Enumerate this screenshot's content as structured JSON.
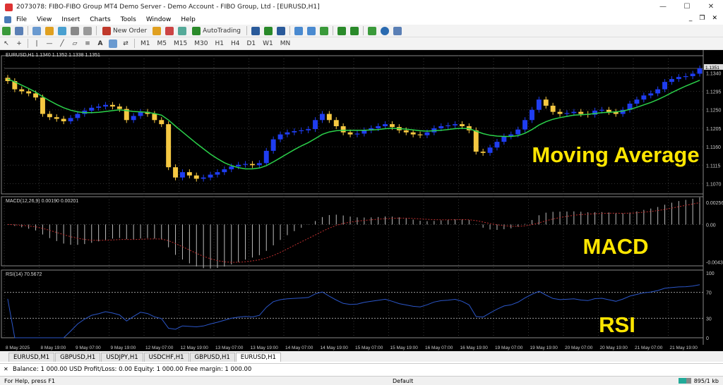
{
  "window": {
    "title": "2073078: FIBO-FIBO Group MT4 Demo Server - Demo Account - FIBO Group, Ltd - [EURUSD,H1]",
    "minimize": "—",
    "maximize": "☐",
    "close": "✕"
  },
  "menu": {
    "items": [
      "File",
      "View",
      "Insert",
      "Charts",
      "Tools",
      "Window",
      "Help"
    ],
    "mdi_min": "_",
    "mdi_restore": "❐",
    "mdi_close": "✕"
  },
  "toolbar": {
    "new_order": "New Order",
    "autotrading": "AutoTrading",
    "timeframes": [
      "M1",
      "M5",
      "M15",
      "M30",
      "H1",
      "H4",
      "D1",
      "W1",
      "MN"
    ]
  },
  "chart": {
    "header": "EURUSD,H1  1.1340 1.1352 1.1338 1.1351",
    "macd_header": "MACD(12,26,9) 0.00190 0.00201",
    "rsi_header": "RSI(14) 70.5672",
    "annotations": {
      "moving_average": "Moving Average",
      "macd": "MACD",
      "rsi": "RSI"
    },
    "colors": {
      "bull": "#1f3df0",
      "bear": "#f5c842",
      "ma": "#2bd14a",
      "rsi": "#2b56c8",
      "annotation": "#ffe600"
    }
  },
  "chart_data": [
    {
      "type": "candlestick",
      "name": "EURUSD,H1",
      "price_ticks": [
        "1.1340",
        "1.1295",
        "1.1250",
        "1.1205",
        "1.1160",
        "1.1115",
        "1.1070"
      ],
      "current_price": "1.1351",
      "ylim": [
        1.1045,
        1.1375
      ],
      "close": [
        1.132,
        1.13,
        1.1295,
        1.129,
        1.128,
        1.124,
        1.1232,
        1.1228,
        1.1222,
        1.123,
        1.124,
        1.1248,
        1.1255,
        1.1258,
        1.1262,
        1.1258,
        1.1252,
        1.1225,
        1.1235,
        1.1245,
        1.124,
        1.1225,
        1.1215,
        1.111,
        1.1085,
        1.1098,
        1.109,
        1.1082,
        1.1085,
        1.1092,
        1.1098,
        1.1105,
        1.1112,
        1.1116,
        1.1118,
        1.1115,
        1.112,
        1.115,
        1.1178,
        1.119,
        1.1195,
        1.1198,
        1.12,
        1.1203,
        1.1225,
        1.124,
        1.1225,
        1.121,
        1.1195,
        1.119,
        1.1192,
        1.12,
        1.1205,
        1.121,
        1.1215,
        1.1208,
        1.12,
        1.1195,
        1.119,
        1.1188,
        1.1195,
        1.1205,
        1.121,
        1.1212,
        1.1215,
        1.121,
        1.12,
        1.1148,
        1.1145,
        1.1158,
        1.1172,
        1.1185,
        1.119,
        1.1202,
        1.1225,
        1.125,
        1.1275,
        1.126,
        1.1245,
        1.124,
        1.1242,
        1.1245,
        1.124,
        1.1238,
        1.1248,
        1.125,
        1.1245,
        1.124,
        1.125,
        1.1265,
        1.1275,
        1.1285,
        1.129,
        1.13,
        1.1318,
        1.1325,
        1.133,
        1.1332,
        1.1338,
        1.1351
      ],
      "ma": [
        1.1325,
        1.1318,
        1.131,
        1.1302,
        1.1293,
        1.1282,
        1.1272,
        1.1263,
        1.1255,
        1.1249,
        1.1245,
        1.1243,
        1.1243,
        1.1244,
        1.1246,
        1.1248,
        1.125,
        1.1248,
        1.1246,
        1.1245,
        1.1244,
        1.1241,
        1.1237,
        1.1225,
        1.121,
        1.1196,
        1.1182,
        1.1168,
        1.1155,
        1.1142,
        1.1131,
        1.1121,
        1.1114,
        1.1109,
        1.1106,
        1.1106,
        1.1108,
        1.1114,
        1.1123,
        1.1133,
        1.1143,
        1.1153,
        1.1162,
        1.117,
        1.118,
        1.119,
        1.1196,
        1.1199,
        1.12,
        1.12,
        1.12,
        1.12,
        1.1201,
        1.1202,
        1.1204,
        1.1205,
        1.1204,
        1.1203,
        1.1201,
        1.1199,
        1.1198,
        1.1199,
        1.12,
        1.1202,
        1.1204,
        1.1205,
        1.1204,
        1.1198,
        1.1192,
        1.1188,
        1.1186,
        1.1185,
        1.1185,
        1.1187,
        1.1193,
        1.1202,
        1.1213,
        1.1221,
        1.1227,
        1.1231,
        1.1234,
        1.1237,
        1.1238,
        1.1239,
        1.1241,
        1.1243,
        1.1244,
        1.1245,
        1.1247,
        1.1251,
        1.1256,
        1.1262,
        1.1268,
        1.1275,
        1.1283,
        1.1292,
        1.13,
        1.1308,
        1.1315,
        1.1322
      ]
    },
    {
      "type": "histogram",
      "name": "MACD(12,26,9)",
      "value_ticks": [
        "0.00256",
        "0.00",
        "-0.00435"
      ],
      "ylim": [
        -0.0048,
        0.0029
      ]
    },
    {
      "type": "line",
      "name": "RSI(14)",
      "levels": [
        "100",
        "70",
        "30",
        "0"
      ],
      "ylim": [
        0,
        100
      ]
    }
  ],
  "time_axis": [
    "8 May 2025",
    "8 May 19:00",
    "9 May 07:00",
    "9 May 19:00",
    "12 May 07:00",
    "12 May 19:00",
    "13 May 07:00",
    "13 May 19:00",
    "14 May 07:00",
    "14 May 19:00",
    "15 May 07:00",
    "15 May 19:00",
    "16 May 07:00",
    "16 May 19:00",
    "19 May 07:00",
    "19 May 19:00",
    "20 May 07:00",
    "20 May 19:00",
    "21 May 07:00",
    "21 May 19:00"
  ],
  "tabs": [
    "EURUSD,M1",
    "GBPUSD,H1",
    "USDJPY,H1",
    "USDCHF,H1",
    "GBPUSD,H1",
    "EURUSD,H1"
  ],
  "balance": {
    "text": "Balance: 1 000.00 USD  Profit/Loss: 0.00  Equity: 1 000.00  Free margin: 1 000.00"
  },
  "status": {
    "help": "For Help, press F1",
    "profile": "Default",
    "connection": "895/1 kb"
  }
}
